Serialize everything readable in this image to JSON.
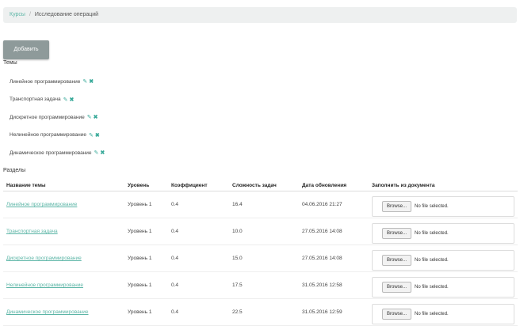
{
  "breadcrumb": {
    "parent": "Курсы",
    "separator": "/",
    "current": "Исследование операций"
  },
  "add_button": "Добавить",
  "topics": {
    "label": "Темы",
    "items": [
      "Линейное программирование",
      "Транспортная задача",
      "Дискретное программирование",
      "Нелинейное программирование",
      "Динамическое программирование"
    ]
  },
  "sections": {
    "label": "Разделы",
    "headers": [
      "Название темы",
      "Уровень",
      "Коэффициент",
      "Сложность задач",
      "Дата обновления",
      "Заполнить из документа"
    ],
    "browse_label": "Browse...",
    "no_file_label": "No file selected.",
    "rows": [
      {
        "name": "Линейное программирование",
        "level": "Уровень 1",
        "coef": "0.4",
        "difficulty": "16.4",
        "date": "04.06.2016 21:27"
      },
      {
        "name": "Транспортная задача",
        "level": "Уровень 1",
        "coef": "0.4",
        "difficulty": "10.0",
        "date": "27.05.2016 14:08"
      },
      {
        "name": "Дискретное программирование",
        "level": "Уровень 1",
        "coef": "0.4",
        "difficulty": "15.0",
        "date": "27.05.2016 14:08"
      },
      {
        "name": "Нелинейное программирование",
        "level": "Уровень 1",
        "coef": "0.4",
        "difficulty": "17.5",
        "date": "31.05.2016 12:58"
      },
      {
        "name": "Динамическое программирование",
        "level": "Уровень 1",
        "coef": "0.4",
        "difficulty": "22.5",
        "date": "31.05.2016 12:59"
      }
    ]
  }
}
